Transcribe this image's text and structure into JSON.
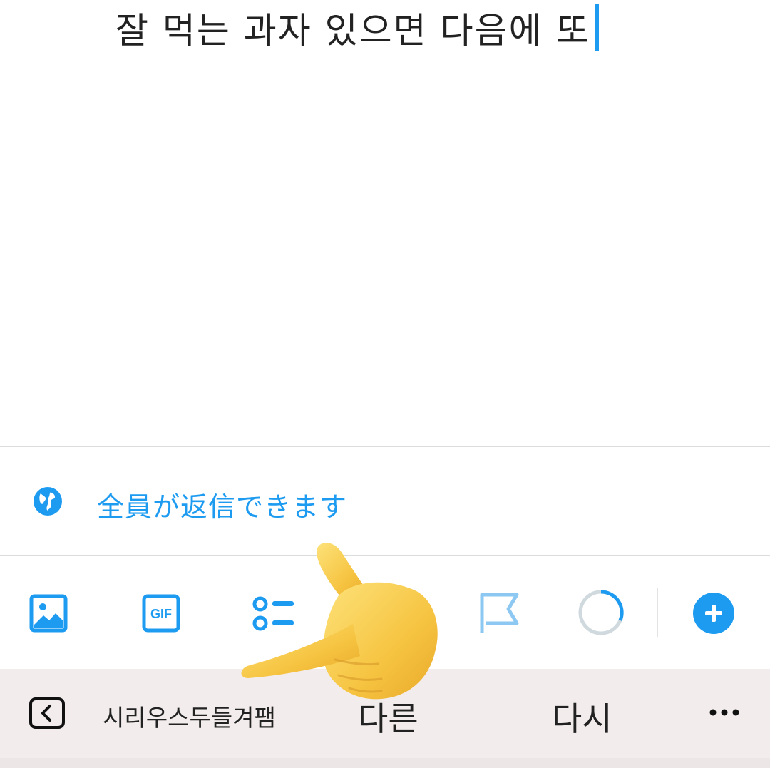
{
  "compose": {
    "text": "잘 먹는 과자 있으면 다음에 또"
  },
  "reply_setting": {
    "label": "全員が返信できます",
    "icon": "globe-icon"
  },
  "toolbar": {
    "icons": [
      "image-icon",
      "gif-icon",
      "poll-icon",
      "location-icon",
      "flag-icon",
      "character-counter-ring",
      "add-thread-icon"
    ],
    "gif_label": "GIF"
  },
  "keyboard_suggestions": {
    "back_icon": "chevron-left-icon",
    "suggestion_1": "시리우스두들겨팸",
    "suggestion_2": "다른",
    "suggestion_3": "다시",
    "more_icon": "ellipsis-icon"
  },
  "overlay": {
    "emoji": "backhand-index-pointing-left"
  },
  "colors": {
    "accent": "#1d9bf0",
    "keyboard_bg": "#f3ecec",
    "emoji_yellow": "#f7c948"
  }
}
